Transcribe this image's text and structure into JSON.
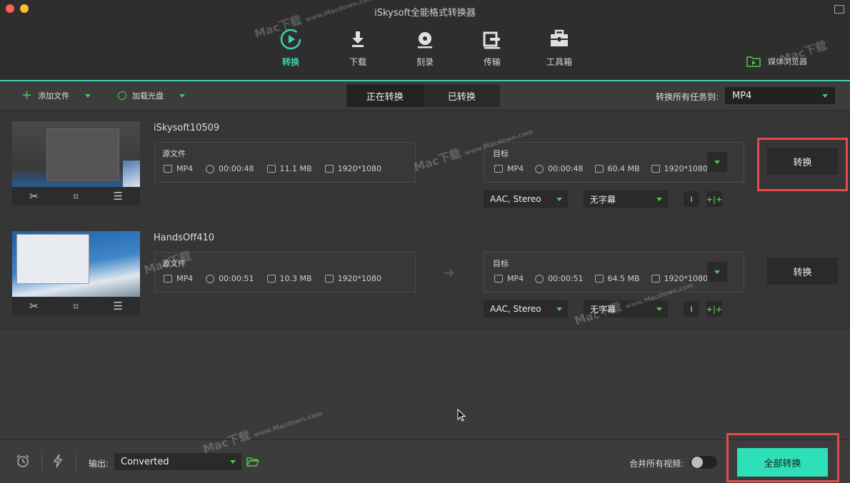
{
  "window": {
    "title": "iSkysoft全能格式转换器"
  },
  "nav": {
    "tabs": [
      {
        "label": "转换",
        "icon": "play-circle-icon",
        "active": true
      },
      {
        "label": "下载",
        "icon": "download-icon",
        "active": false
      },
      {
        "label": "刻录",
        "icon": "disc-icon",
        "active": false
      },
      {
        "label": "传输",
        "icon": "transfer-icon",
        "active": false
      },
      {
        "label": "工具箱",
        "icon": "toolbox-icon",
        "active": false
      }
    ],
    "media_browser": "媒体浏览器"
  },
  "toolbar": {
    "add_file": "添加文件",
    "load_disc": "加载光盘",
    "segments": [
      "正在转换",
      "已转换"
    ],
    "convert_all_to_label": "转换所有任务到:",
    "format": "MP4"
  },
  "files": [
    {
      "name": "iSkysoft10509",
      "source_label": "源文件",
      "source": {
        "format": "MP4",
        "duration": "00:00:48",
        "size": "11.1 MB",
        "resolution": "1920*1080"
      },
      "target_label": "目标",
      "target": {
        "format": "MP4",
        "duration": "00:00:48",
        "size": "60.4 MB",
        "resolution": "1920*1080"
      },
      "audio": "AAC, Stereo",
      "subtitle": "无字幕",
      "convert_label": "转换"
    },
    {
      "name": "HandsOff410",
      "source_label": "源文件",
      "source": {
        "format": "MP4",
        "duration": "00:00:51",
        "size": "10.3 MB",
        "resolution": "1920*1080"
      },
      "target_label": "目标",
      "target": {
        "format": "MP4",
        "duration": "00:00:51",
        "size": "64.5 MB",
        "resolution": "1920*1080"
      },
      "audio": "AAC, Stereo",
      "subtitle": "无字幕",
      "convert_label": "转换"
    }
  ],
  "bottom": {
    "output_label": "输出:",
    "output_value": "Converted",
    "merge_label": "合并所有视频:",
    "merge_enabled": false,
    "convert_all_label": "全部转换"
  },
  "watermark": {
    "text": "Mac下载",
    "url": "www.Macdown.com"
  },
  "colors": {
    "accent": "#3fd0b0",
    "green_icon": "#4fc84f",
    "highlight": "#e54b4b",
    "convert_all_bg": "#2ee0b8"
  }
}
